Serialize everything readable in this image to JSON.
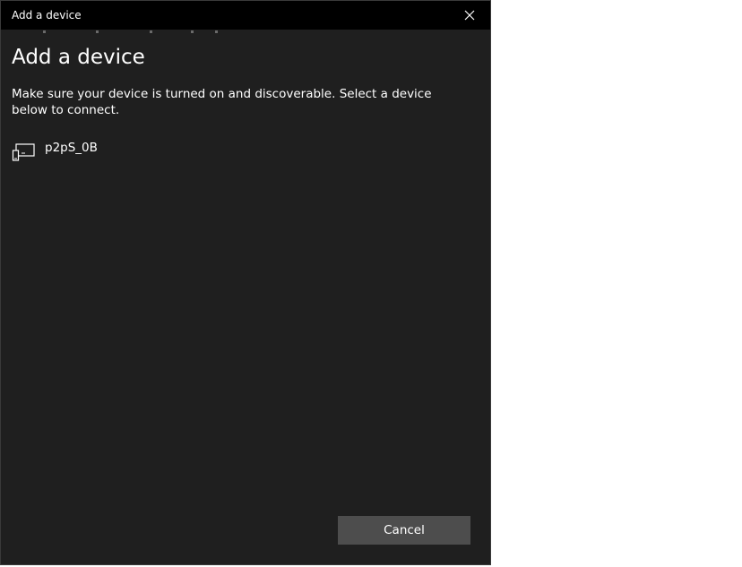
{
  "window": {
    "title": "Add a device",
    "close_icon": "close-icon"
  },
  "main": {
    "heading": "Add a device",
    "instructions": "Make sure your device is turned on and discoverable. Select a device below to connect."
  },
  "devices": [
    {
      "label": "p2pS_0B",
      "icon": "display-device-icon"
    }
  ],
  "footer": {
    "cancel_label": "Cancel"
  },
  "colors": {
    "dialog_bg": "#1f1f1f",
    "titlebar_bg": "#000000",
    "button_bg": "#4d4d4d",
    "text": "#ffffff"
  }
}
